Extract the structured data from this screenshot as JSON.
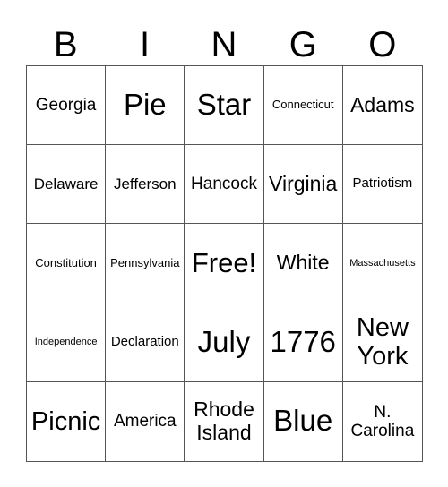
{
  "header": {
    "letters": [
      "B",
      "I",
      "N",
      "G",
      "O"
    ]
  },
  "card": {
    "rows": [
      [
        "Georgia",
        "Pie",
        "Star",
        "Connecticut",
        "Adams"
      ],
      [
        "Delaware",
        "Jefferson",
        "Hancock",
        "Virginia",
        "Patriotism"
      ],
      [
        "Constitution",
        "Pennsylvania",
        "Free!",
        "White",
        "Massachusetts"
      ],
      [
        "Independence",
        "Declaration",
        "July",
        "1776",
        "New York"
      ],
      [
        "Picnic",
        "America",
        "Rhode Island",
        "Blue",
        "N. Carolina"
      ]
    ]
  }
}
